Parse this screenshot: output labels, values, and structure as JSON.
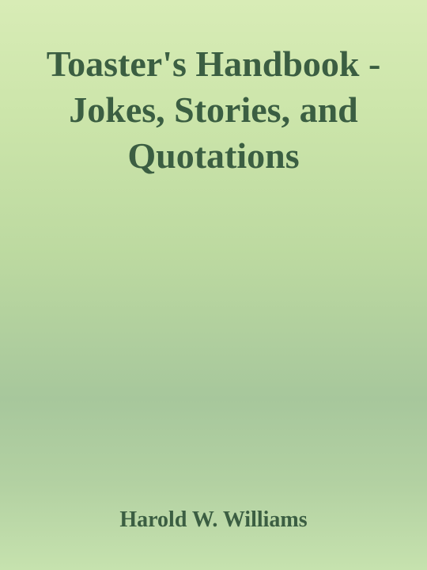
{
  "cover": {
    "title": "Toaster's Handbook - Jokes, Stories, and Quotations",
    "author": "Harold W. Williams"
  }
}
